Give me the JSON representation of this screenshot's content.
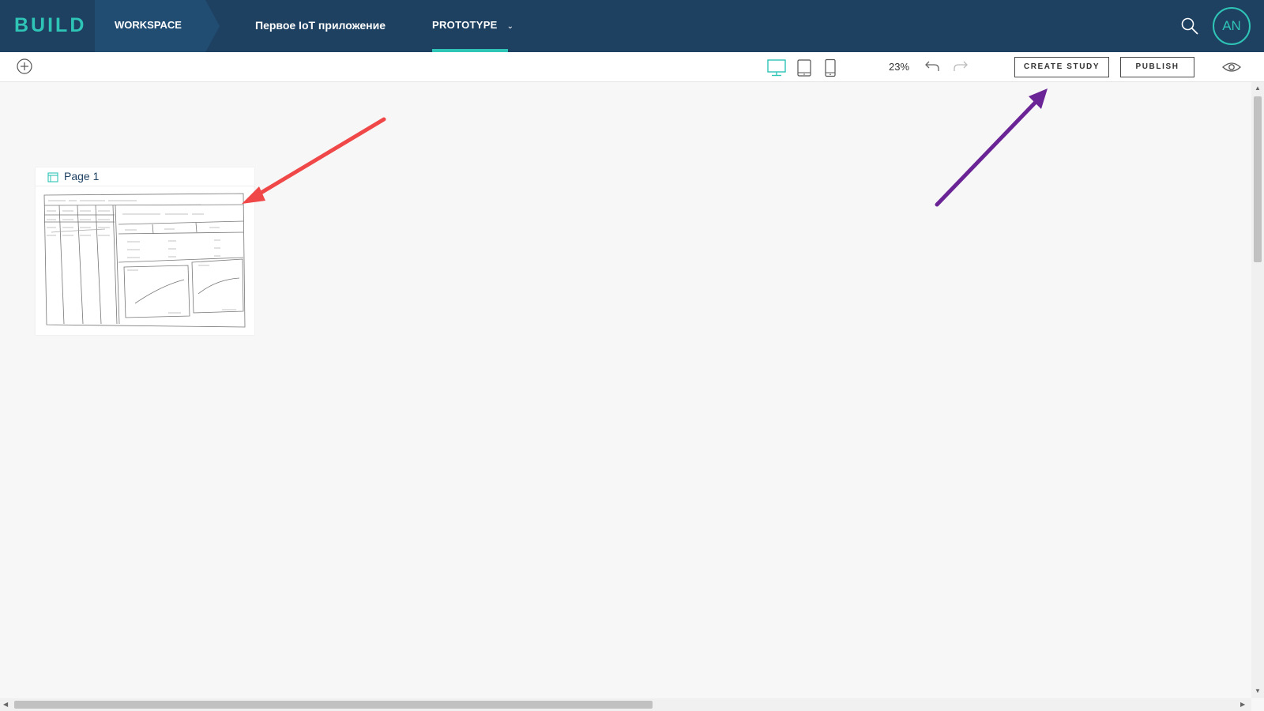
{
  "app": {
    "logo": "BUILD"
  },
  "nav": {
    "workspace": "WORKSPACE",
    "project": "Первое IoT приложение",
    "mode": "PROTOTYPE",
    "avatar_initials": "AN"
  },
  "toolbar": {
    "zoom": "23%",
    "create_study": "CREATE STUDY",
    "publish": "PUBLISH"
  },
  "canvas": {
    "page": {
      "name": "Page 1"
    }
  },
  "colors": {
    "nav_bg": "#1e4162",
    "accent": "#2ec4b6",
    "arrow_red": "#f04848",
    "arrow_purple": "#6a2496"
  },
  "icons": [
    "search-icon",
    "add-icon",
    "desktop-icon",
    "tablet-icon",
    "phone-icon",
    "undo-icon",
    "redo-icon",
    "eye-icon",
    "page-icon",
    "chevron-down-icon"
  ]
}
